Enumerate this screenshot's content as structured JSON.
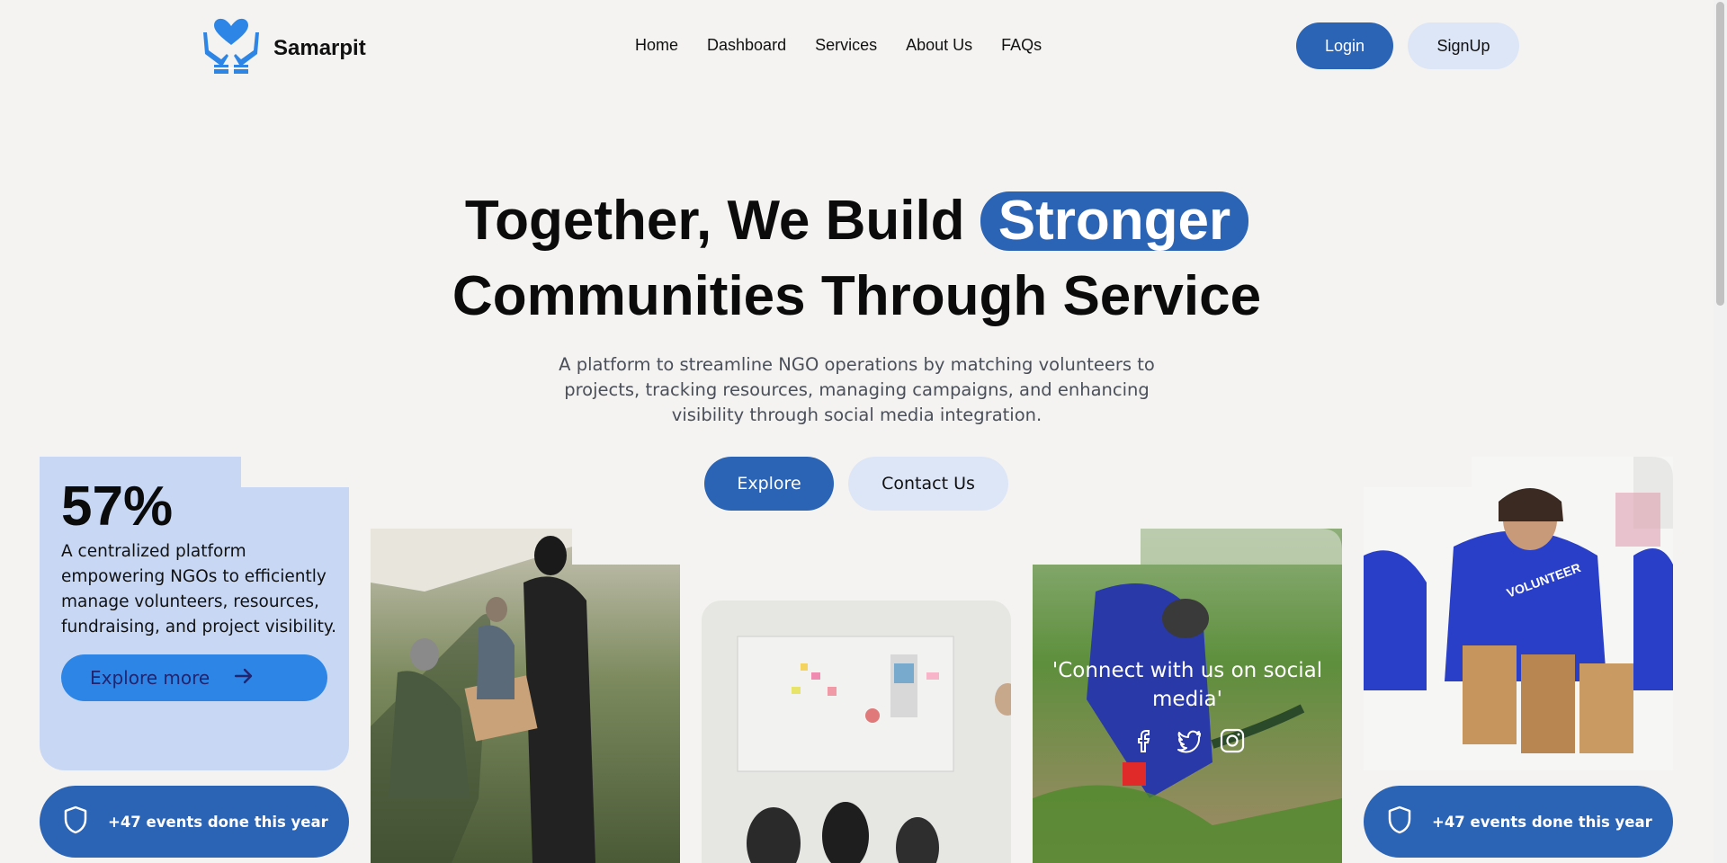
{
  "brand": {
    "name": "Samarpit"
  },
  "nav": {
    "links": [
      "Home",
      "Dashboard",
      "Services",
      "About Us",
      "FAQs"
    ],
    "login": "Login",
    "signup": "SignUp"
  },
  "hero": {
    "title_part1": "Together, We Build",
    "title_highlight": "Stronger",
    "title_line2": "Communities Through Service",
    "subtitle": "A platform to streamline NGO operations by matching volunteers to projects, tracking resources, managing campaigns, and enhancing visibility through social media integration.",
    "explore": "Explore",
    "contact": "Contact Us"
  },
  "stat": {
    "value": "57%",
    "description": "A centralized platform empowering NGOs to efficiently manage volunteers, resources, fundraising, and project visibility.",
    "cta": "Explore more"
  },
  "events": {
    "left": "+47 events done this year",
    "right": "+47 events done this year"
  },
  "social": {
    "text": "'Connect with us on social media'"
  },
  "colors": {
    "primary": "#2b63b5",
    "light": "#dde6f6",
    "card": "#c8d8f4",
    "accent": "#2d86e6",
    "bg": "#f4f3f1"
  },
  "icons": [
    "hands-heart-logo-icon",
    "arrow-right-icon",
    "shield-icon",
    "facebook-icon",
    "twitter-icon",
    "instagram-icon"
  ]
}
